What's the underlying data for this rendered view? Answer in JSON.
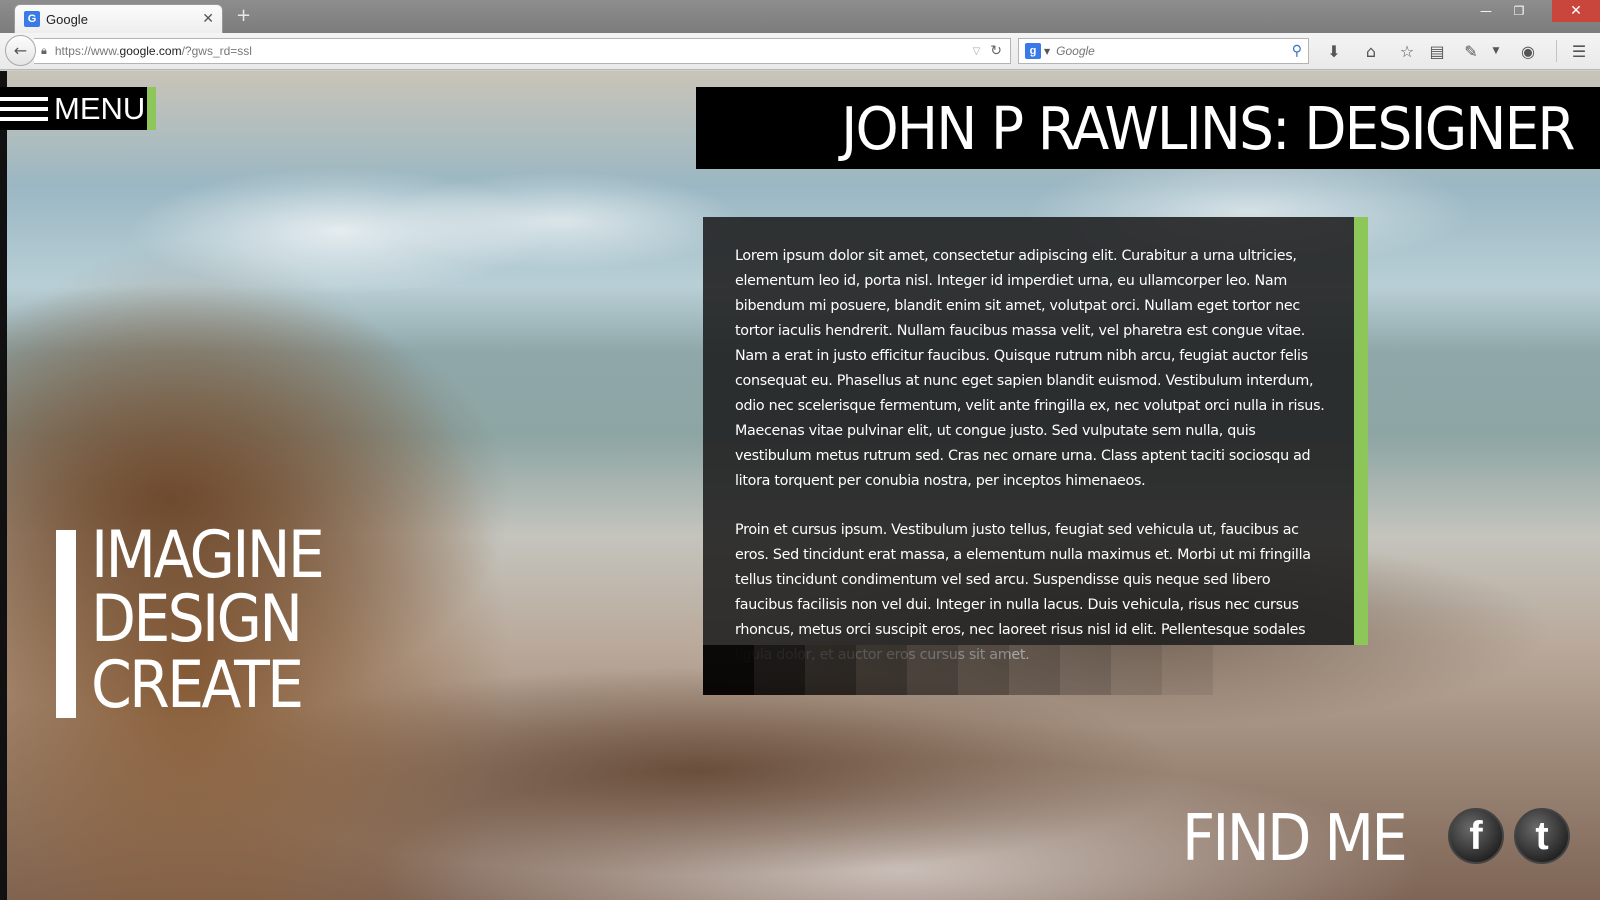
{
  "browser": {
    "tab_title": "Google",
    "tab_favicon": "G",
    "url_prefix": "https://www.",
    "url_domain": "google.com",
    "url_suffix": "/?gws_rd=ssl",
    "search_engine_icon": "g",
    "search_placeholder": "Google",
    "new_tab_label": "+",
    "close_tab_label": "✕"
  },
  "page": {
    "menu_label": "MENU",
    "title": "JOHN P RAWLINS: DESIGNER",
    "paragraphs": [
      "Lorem ipsum dolor sit amet, consectetur adipiscing elit. Curabitur a urna ultricies, elementum leo id, porta nisl. Integer id imperdiet urna, eu ullamcorper leo. Nam bibendum mi posuere, blandit enim sit amet, volutpat orci. Nullam eget tortor nec tortor iaculis hendrerit. Nullam faucibus massa velit, vel pharetra est congue vitae. Nam a erat in justo efficitur faucibus. Quisque rutrum nibh arcu, feugiat auctor felis consequat eu. Phasellus at nunc eget sapien blandit euismod. Vestibulum interdum, odio nec scelerisque fermentum, velit ante fringilla ex, nec volutpat orci nulla in risus. Maecenas vitae pulvinar elit, ut congue justo. Sed vulputate sem nulla, quis vestibulum metus rutrum sed. Cras nec ornare urna. Class aptent taciti sociosqu ad litora torquent per conubia nostra, per inceptos himenaeos.",
      "Proin et cursus ipsum. Vestibulum justo tellus, feugiat sed vehicula ut, faucibus ac eros. Sed tincidunt erat massa, a elementum nulla maximus et. Morbi ut mi fringilla tellus tincidunt condimentum vel sed arcu. Suspendisse quis neque sed libero faucibus facilisis non vel dui. Integer in nulla lacus. Duis vehicula, risus nec cursus rhoncus, metus orci suscipit eros, nec laoreet risus nisl id elit. Pellentesque sodales ligula dolor, et auctor eros cursus sit amet."
    ],
    "tagline": [
      "IMAGINE",
      "DESIGN",
      "CREATE"
    ],
    "find_me": "FIND ME",
    "social": [
      {
        "name": "facebook",
        "glyph": "f"
      },
      {
        "name": "twitter",
        "glyph": "t"
      }
    ],
    "colors": {
      "accent_green": "#8dc75a",
      "box_black": "#000000"
    }
  }
}
